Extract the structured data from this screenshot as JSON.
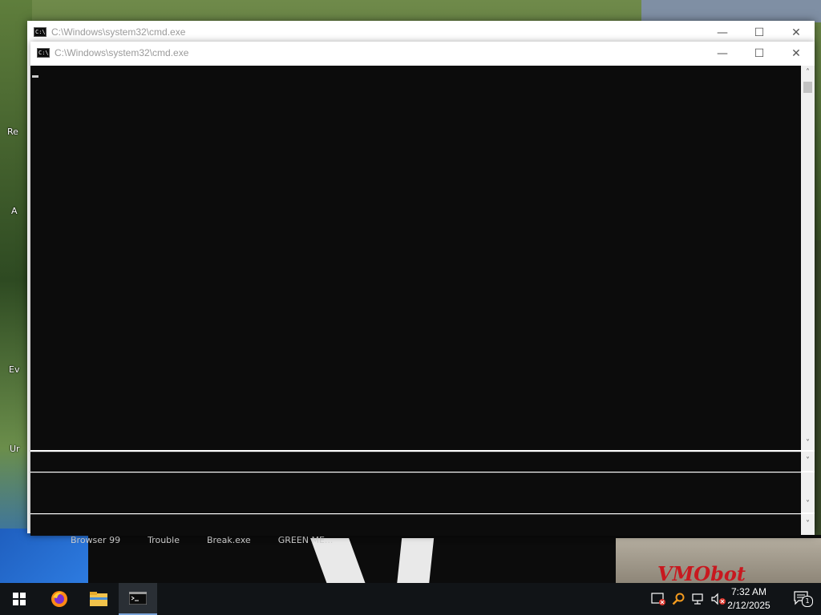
{
  "desktop": {
    "icon_labels_left": [
      "Re",
      "A",
      "Ev",
      "Ur"
    ],
    "behind_labels": [
      "Browser 99",
      "Trouble",
      "Break.exe",
      "GREEN ME..."
    ],
    "wallpaper_text": "VMObot"
  },
  "window_back": {
    "title": "C:\\Windows\\system32\\cmd.exe",
    "minimize": "—",
    "maximize": "☐",
    "close": "✕"
  },
  "window_front": {
    "title": "C:\\Windows\\system32\\cmd.exe",
    "minimize": "—",
    "maximize": "☐",
    "close": "✕",
    "console_text": ""
  },
  "taskbar": {
    "time": "7:32 AM",
    "date": "2/12/2025",
    "notification_count": "1",
    "icons": [
      "windows-start-icon",
      "firefox-icon",
      "file-explorer-icon",
      "cmd-icon"
    ],
    "tray_icons": [
      "security-alert-icon",
      "search-tool-icon",
      "network-icon",
      "volume-muted-icon"
    ]
  }
}
